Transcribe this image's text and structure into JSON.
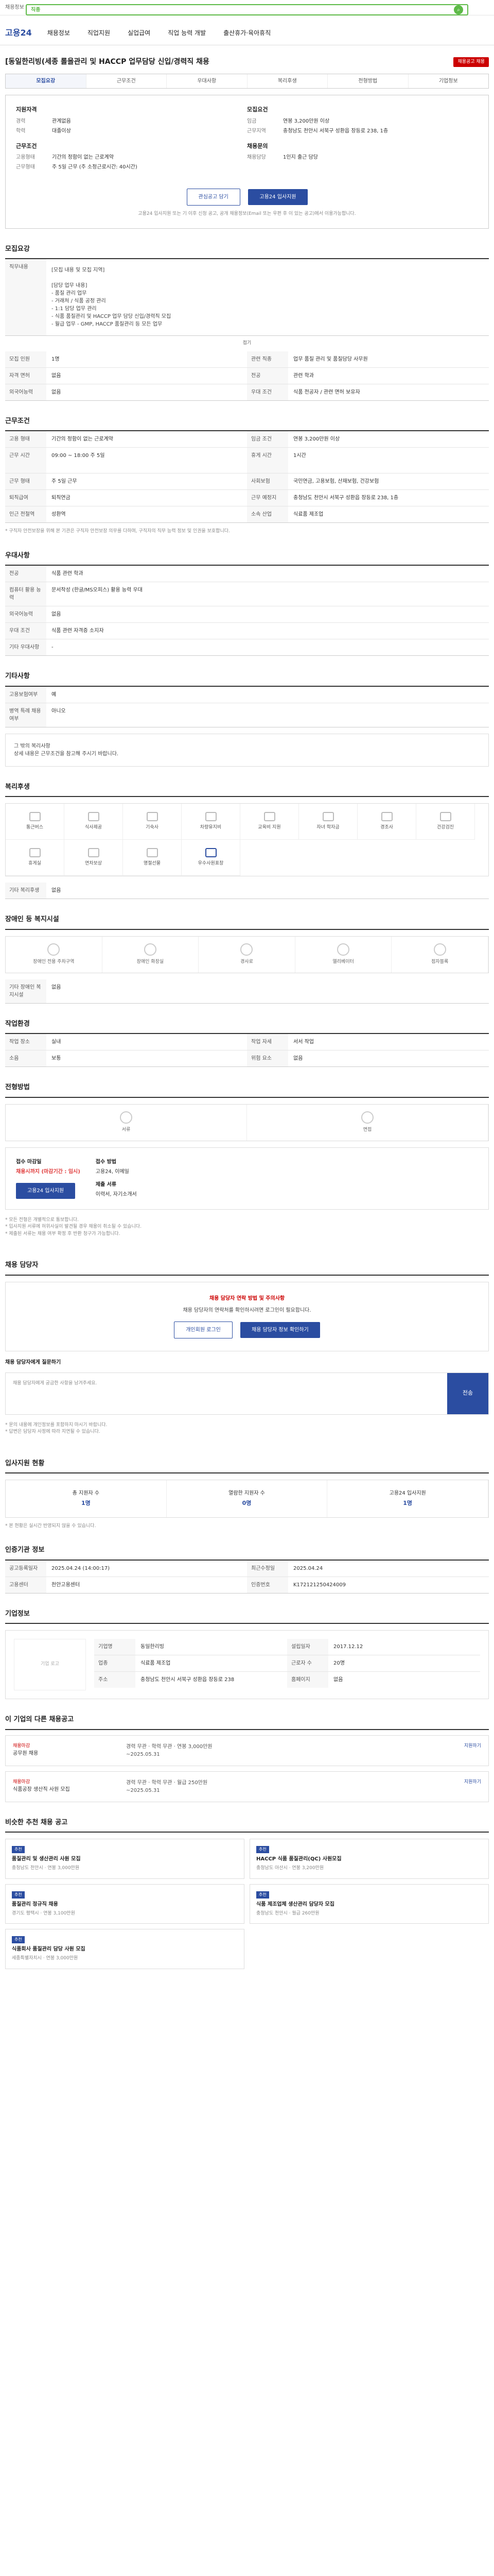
{
  "site": {
    "topbar_text": "채용정보 검색",
    "search_placeholder": "직종",
    "logo": "고용24",
    "nav": [
      "채용정보",
      "직업지원",
      "실업급여",
      "직업 능력 개발",
      "출산휴가·육아휴직"
    ]
  },
  "job": {
    "title": "[동일한리빙(세종 롤을관리 및 HACCP 업무담당 신입/경력직 채용",
    "applicant_button": "채용공고 채용",
    "tabs": [
      "모집요강",
      "근무조건",
      "우대사항",
      "복리후생",
      "전형방법",
      "기업정보"
    ],
    "summary_left_title": "지원자격",
    "summary_left": [
      {
        "k": "경력",
        "v": "관계없음"
      },
      {
        "k": "학력",
        "v": "대졸이상"
      }
    ],
    "summary_left2_title": "근무조건",
    "summary_left2": [
      {
        "k": "고용형태",
        "v": "기간의 정함이 없는 근로계약"
      },
      {
        "k": "근무형태",
        "v": "주 5일 근무 (주 소정근로시간: 40시간)"
      }
    ],
    "summary_right_title": "모집요건",
    "summary_right": [
      {
        "k": "임금",
        "v": "연봉 3,200만원 이상"
      },
      {
        "k": "근무지역",
        "v": "충청남도 천안시 서북구 성환읍 장등로 238, 1층"
      }
    ],
    "summary_right2_title": "채용문의",
    "summary_right2": [
      {
        "k": "채용담당",
        "v": "1인지 출근 담당"
      }
    ],
    "btn_like": "관심공고 담기",
    "btn_apply": "고용24 입사지원",
    "apply_note": "고용24 입사지원 또는 기 이후 신청 공고, 공개 채용정보(Email 또는 우편 후 이 있는 공고)에서 이용가능합니다."
  },
  "recruit": {
    "heading": "모집요강",
    "duty_title": "직무내용",
    "duty_text": "[모집 내용 및 모집 지역]\n\n[담당 업무 내용]\n- 품질 관리 업무\n- 거래처 / 식품 공정 관리\n- 1:1 담당 업무 관리\n- 식품 품질관리 및 HACCP 업무 담당 신입/경력직 모집\n- 월급 업무 - GMP, HACCP 품질관리 등 모든 업무",
    "collapse": "접기",
    "rows": [
      {
        "k": "모집 인원",
        "v": "1명"
      },
      {
        "k": "관련 직종",
        "v": "업무 품질 관리 및 품질담당 사무원"
      },
      {
        "k": "자격 면허",
        "v": "없음"
      },
      {
        "k": "전공",
        "v": "관련 학과"
      },
      {
        "k": "외국어능력",
        "v": "없음"
      },
      {
        "k": "우대 조건",
        "v": "식품 전공자 / 관련 면허 보유자"
      }
    ]
  },
  "conditions": {
    "heading": "근무조건",
    "rows": [
      {
        "k": "고용 형태",
        "v": "기간의 정함이 없는 근로계약"
      },
      {
        "k": "임금 조건",
        "v": "연봉 3,200만원 이상"
      },
      {
        "k": "근무 시간",
        "v": "09:00 ~ 18:00 주 5일"
      },
      {
        "k": "휴게 시간",
        "v": "1시간"
      },
      {
        "k": "근무 형태",
        "v": "주 5일 근무"
      },
      {
        "k": "사회보험",
        "v": "국민연금, 고용보험, 산재보험, 건강보험"
      },
      {
        "k": "퇴직급여",
        "v": "퇴직연금"
      },
      {
        "k": "근무 예정지",
        "v": "충청남도 천안시 서북구 성환읍 장등로 238, 1층"
      },
      {
        "k": "인근 전철역",
        "v": "성환역"
      },
      {
        "k": "소속 산업",
        "v": "식료품 제조업"
      }
    ],
    "note": "* 구직자 안전보장을 위해 본 기관은 구직자 안전보장 의무를 다하며, 구직자의 직무 능력 정보 및 인권을 보호합니다."
  },
  "preference": {
    "heading": "우대사항",
    "rows": [
      {
        "k": "전공",
        "v": "식품 관련 학과"
      },
      {
        "k": "컴퓨터 활용 능력",
        "v": "문서작성 (한글/MS오피스) 활용 능력 우대"
      },
      {
        "k": "외국어능력",
        "v": "없음"
      },
      {
        "k": "우대 조건",
        "v": "식품 관련 자격증 소지자"
      },
      {
        "k": "기타 우대사항",
        "v": "-"
      }
    ]
  },
  "other": {
    "heading": "기타사항",
    "rows": [
      {
        "k": "고용보험여부",
        "v": "예"
      },
      {
        "k": "병역 특례 채용 여부",
        "v": "아니오"
      }
    ],
    "box_text": "그 밖의 복리사항\n상세 내용은 근무조건을 참고해 주시기 바랍니다."
  },
  "welfare": {
    "heading": "복리후생",
    "items": [
      "통근버스",
      "식사제공",
      "기숙사",
      "차량유지비",
      "교육비 지원",
      "자녀 학자금",
      "경조사",
      "건강검진",
      "휴게실",
      "연차보상",
      "명절선물",
      "우수사원표창"
    ],
    "extra_title": "기타 복리후생",
    "extra_value": "없음"
  },
  "disabled": {
    "heading": "장애인 등 복지시설",
    "items": [
      "장애인 전용 주차구역",
      "장애인 화장실",
      "경사로",
      "엘리베이터",
      "점자블록"
    ],
    "extra_title": "기타 장애인 복지시설",
    "extra_value": "없음"
  },
  "workplace": {
    "heading": "작업환경",
    "rows": [
      {
        "k": "작업 장소",
        "v": "실내"
      },
      {
        "k": "작업 자세",
        "v": "서서 작업"
      },
      {
        "k": "소음",
        "v": "보통"
      },
      {
        "k": "위험 요소",
        "v": "없음"
      }
    ]
  },
  "process": {
    "heading": "전형방법",
    "steps": [
      "서류",
      "면접"
    ],
    "apply_title": "접수 마감일",
    "apply_deadline": "채용시까지 (마감기간 : 임시)",
    "method_title": "접수 방법",
    "method": "고용24, 이메일",
    "docs_title": "제출 서류",
    "docs": "이력서, 자기소개서",
    "apply_btn": "고용24 입사지원",
    "notes": "* 모든 전형은 개별적으로 통보합니다.\n* 입사지원 서류에 허위사실이 발견될 경우 채용이 취소될 수 있습니다.\n* 제출된 서류는 채용 여부 확정 후 반환 청구가 가능합니다."
  },
  "inquiry": {
    "heading": "채용 담당자",
    "warn": "채용 담당자 연락 방법 및 주의사항",
    "text": "채용 담당자의 연락처를 확인하시려면 로그인이 필요합니다.",
    "btn_login": "개인회원 로그인",
    "btn_check": "채용 담당자 정보 확인하기",
    "qa_title": "채용 담당자에게 질문하기",
    "qa_placeholder": "채용 담당자에게 궁금한 사항을 남겨주세요.",
    "qa_send": "전송",
    "qa_notes": "* 문의 내용에 개인정보를 포함하지 마시기 바랍니다.\n* 답변은 담당자 사정에 따라 지연될 수 있습니다."
  },
  "stats": {
    "heading": "입사지원 현황",
    "items": [
      {
        "label": "총 지원자 수",
        "value": "1명"
      },
      {
        "label": "열람한 지원자 수",
        "value": "0명"
      },
      {
        "label": "고용24 입사지원",
        "value": "1명"
      }
    ],
    "note": "* 본 현황은 실시간 반영되지 않을 수 있습니다."
  },
  "notice": {
    "heading": "인증기관 정보",
    "rows": [
      {
        "k": "공고등록일자",
        "v": "2025.04.24 (14:00:17)"
      },
      {
        "k": "최근수정일",
        "v": "2025.04.24"
      },
      {
        "k": "고용센터",
        "v": "천안고용센터"
      },
      {
        "k": "인증번호",
        "v": "K172121250424009"
      }
    ]
  },
  "company": {
    "heading": "기업정보",
    "logo_text": "기업 로고",
    "rows": [
      {
        "k": "기업명",
        "v": "동일한리빙"
      },
      {
        "k": "설립일자",
        "v": "2017.12.12"
      },
      {
        "k": "업종",
        "v": "식료품 제조업"
      },
      {
        "k": "근로자 수",
        "v": "20명"
      },
      {
        "k": "주소",
        "v": "충청남도 천안시 서북구 성환읍 장등로 238"
      },
      {
        "k": "홈페이지",
        "v": "없음"
      }
    ]
  },
  "other_jobs": {
    "heading": "이 기업의 다른 채용공고",
    "jobs": [
      {
        "tag": "채용마감",
        "title": "공무원 채용",
        "info": "경력 무관 · 학력 무관 · 연봉 3,000만원",
        "date": "~2025.05.31",
        "d": "지원하기"
      },
      {
        "tag": "채용마감",
        "title": "식품공장 생산직 사원 모집",
        "info": "경력 무관 · 학력 무관 · 월급 250만원",
        "date": "~2025.05.31",
        "d": "지원하기"
      }
    ]
  },
  "recommend": {
    "heading": "비슷한 추천 채용 공고",
    "cards": [
      {
        "badge": "추천",
        "title": "품질관리 및 생산관리 사원 모집",
        "meta": "충청남도 천안시 · 연봉 3,000만원"
      },
      {
        "badge": "추천",
        "title": "HACCP 식품 품질관리(QC) 사원모집",
        "meta": "충청남도 아산시 · 연봉 3,200만원"
      },
      {
        "badge": "추천",
        "title": "품질관리 정규직 채용",
        "meta": "경기도 평택시 · 연봉 3,100만원"
      },
      {
        "badge": "추천",
        "title": "식품 제조업체 생산관리 담당자 모집",
        "meta": "충청남도 천안시 · 월급 260만원"
      },
      {
        "badge": "추천",
        "title": "식품회사 품질관리 담당 사원 모집",
        "meta": "세종특별자치시 · 연봉 3,000만원"
      }
    ]
  }
}
